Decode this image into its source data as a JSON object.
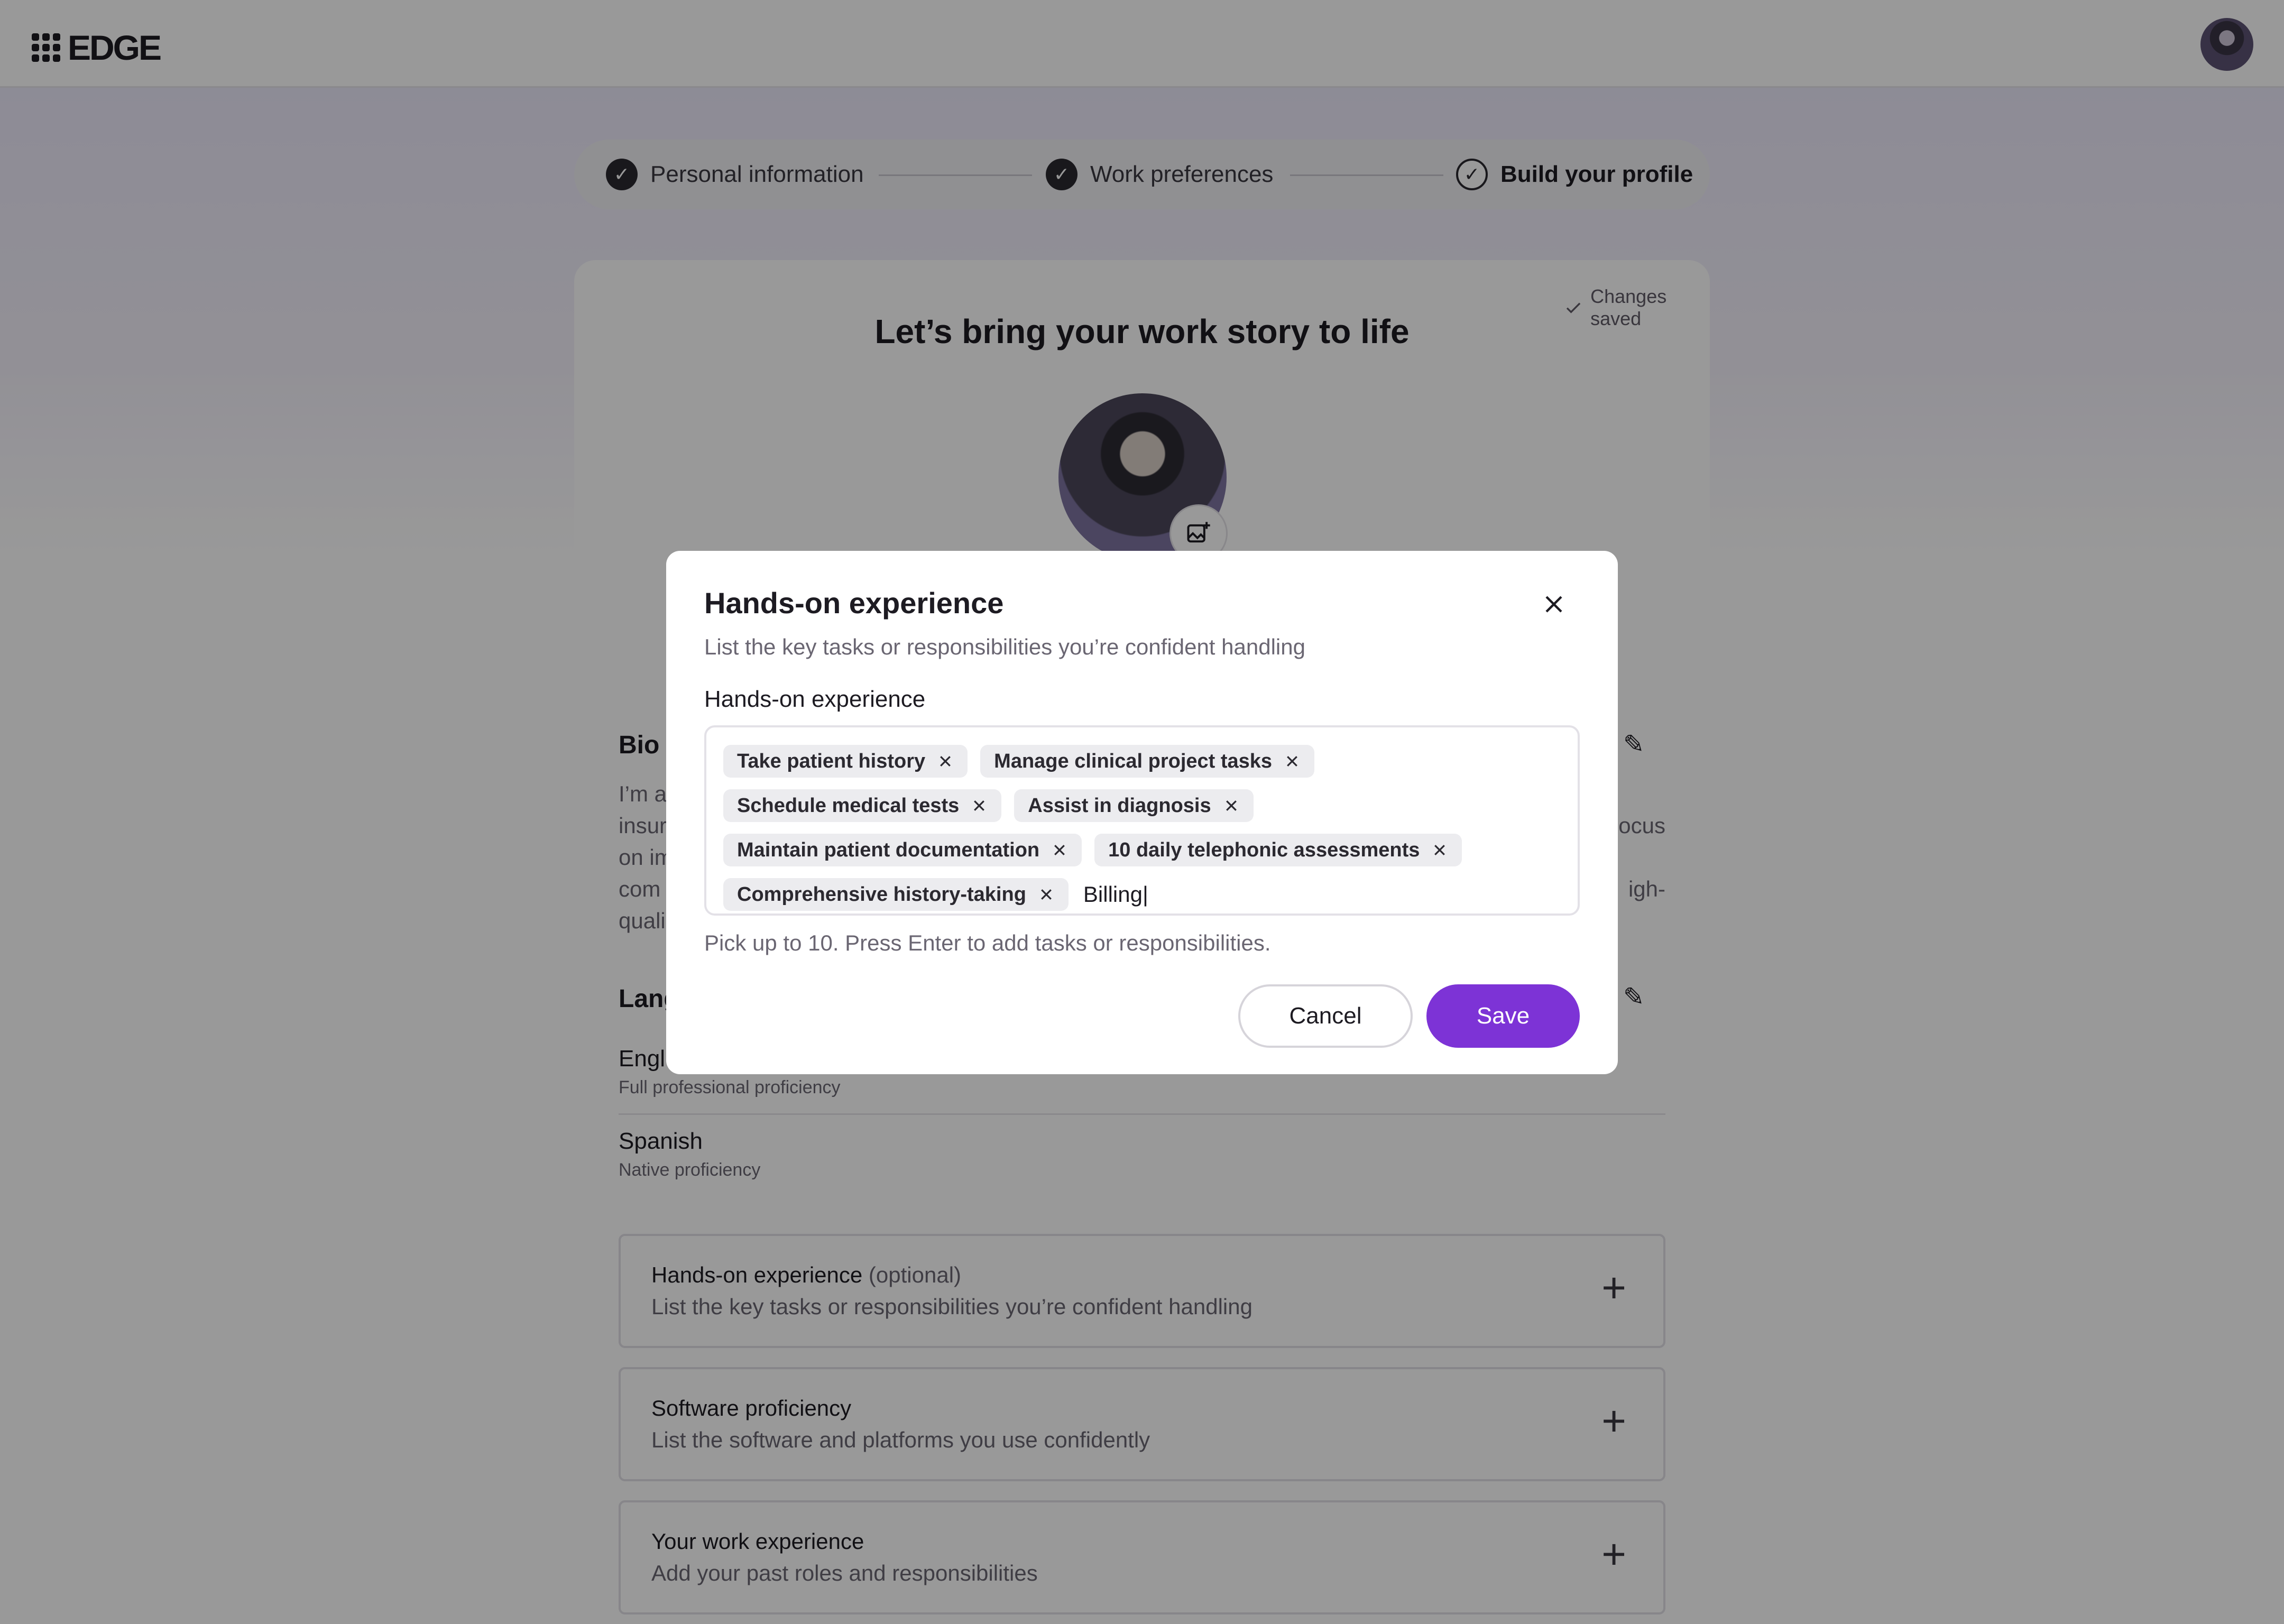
{
  "app": {
    "logo_text": "EDGE"
  },
  "stepper": {
    "steps": [
      {
        "label": "Personal information",
        "state": "done"
      },
      {
        "label": "Work preferences",
        "state": "done"
      },
      {
        "label": "Build your profile",
        "state": "current"
      }
    ]
  },
  "card": {
    "status": "Changes saved",
    "title": "Let’s bring your work story to life",
    "bio_heading": "Bio",
    "bio_text_fragments": {
      "line1_start": "I’m a",
      "line2_start": "insur",
      "line2_end": "ocus",
      "line3_start": "on im",
      "line4_start": "com",
      "line4_end": "igh-",
      "line5_start": "quali"
    },
    "languages_heading": "Lang",
    "languages": [
      {
        "name": "Engl",
        "level": "Full professional proficiency"
      },
      {
        "name": "Spanish",
        "level": "Native proficiency"
      }
    ],
    "sections": [
      {
        "title": "Hands-on experience",
        "optional": "(optional)",
        "subtitle": "List the key tasks or responsibilities you’re confident handling"
      },
      {
        "title": "Software proficiency",
        "optional": "",
        "subtitle": "List the software and platforms you use confidently"
      },
      {
        "title": "Your work experience",
        "optional": "",
        "subtitle": "Add your past roles and responsibilities"
      }
    ]
  },
  "modal": {
    "title": "Hands-on experience",
    "subtitle": "List the key tasks or responsibilities you’re confident handling",
    "field_label": "Hands-on experience",
    "tags": [
      "Take patient history",
      "Manage clinical project tasks",
      "Schedule medical tests",
      "Assist in diagnosis",
      "Maintain patient documentation",
      "10 daily telephonic assessments",
      "Comprehensive history-taking"
    ],
    "input_value": "Billing|",
    "hint": "Pick up to 10. Press Enter to add tasks or responsibilities.",
    "cancel_label": "Cancel",
    "save_label": "Save"
  },
  "colors": {
    "accent": "#7d33d6",
    "overlay": "rgba(0,0,0,0.4)"
  },
  "icons": [
    "grid-logo-icon",
    "check-icon",
    "image-edit-icon",
    "pencil-icon",
    "plus-icon",
    "close-icon"
  ]
}
